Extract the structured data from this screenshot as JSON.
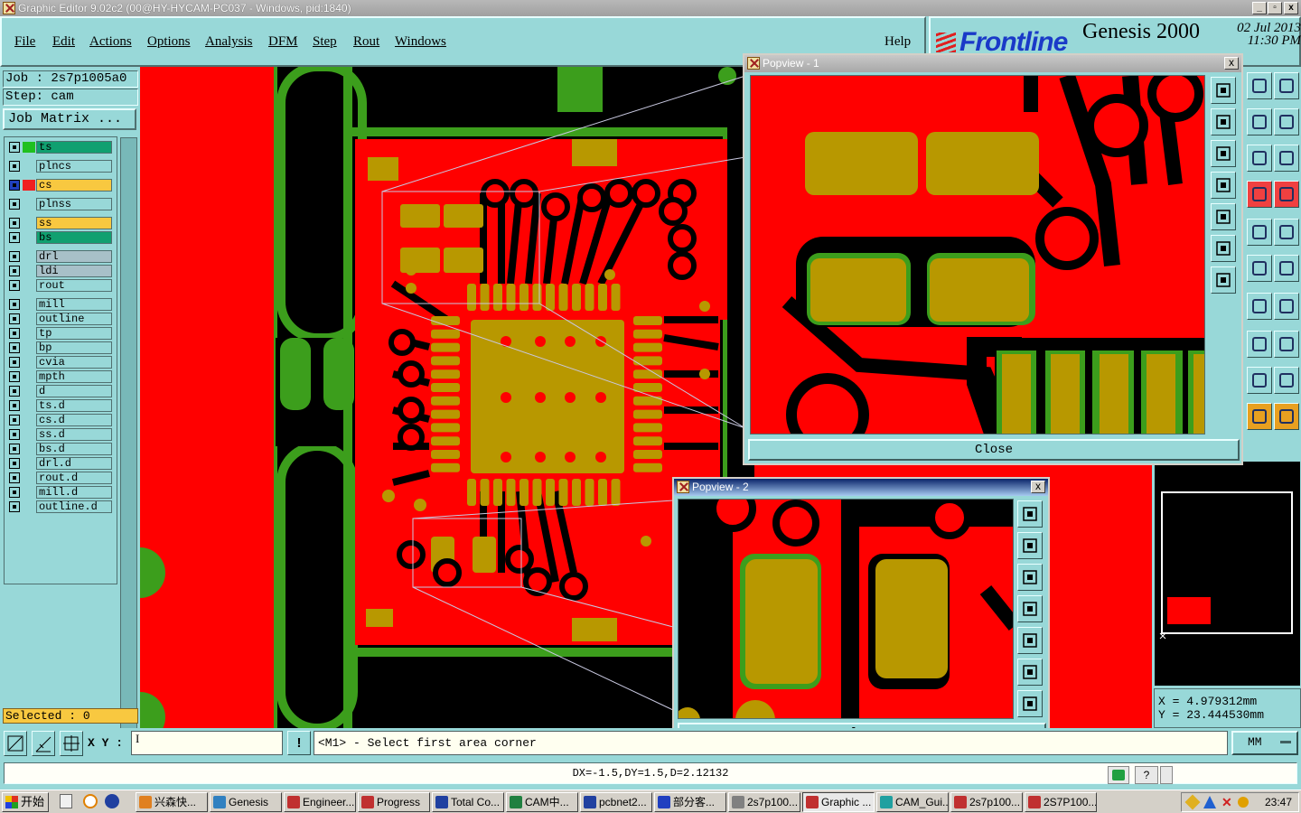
{
  "window": {
    "title": "Graphic Editor 9.02c2 (00@HY-HYCAM-PC037 - Windows, pid:1840)"
  },
  "menu": [
    "File",
    "Edit",
    "Actions",
    "Options",
    "Analysis",
    "DFM",
    "Step",
    "Rout",
    "Windows"
  ],
  "help": "Help",
  "brand": {
    "logo": "Frontline",
    "product": "Genesis 2000",
    "date": "02 Jul 2013",
    "time": "11:30 PM"
  },
  "job": {
    "job": "Job : 2s7p1005a0",
    "step": "Step: cam",
    "matrix_button": "Job Matrix ..."
  },
  "layers": [
    {
      "name": "ts",
      "color": "#10a070",
      "check": "#20c020"
    },
    {
      "name": "plncs",
      "color": "#98d8d8",
      "check": ""
    },
    {
      "name": "cs",
      "color": "#f8c840",
      "check": "#f02020",
      "selected": true
    },
    {
      "name": "plnss",
      "color": "#98d8d8",
      "check": ""
    },
    {
      "name": "ss",
      "color": "#f8c840",
      "check": ""
    },
    {
      "name": "bs",
      "color": "#10a070",
      "check": ""
    },
    {
      "name": "drl",
      "color": "#a8c0c8",
      "check": ""
    },
    {
      "name": "ldi",
      "color": "#a8c0c8",
      "check": ""
    },
    {
      "name": "rout",
      "color": "#98d8d8",
      "check": ""
    },
    {
      "name": "mill",
      "color": "#98d8d8",
      "check": ""
    },
    {
      "name": "outline",
      "color": "#98d8d8",
      "check": ""
    },
    {
      "name": "tp",
      "color": "#98d8d8",
      "check": ""
    },
    {
      "name": "bp",
      "color": "#98d8d8",
      "check": ""
    },
    {
      "name": "cvia",
      "color": "#98d8d8",
      "check": ""
    },
    {
      "name": "mpth",
      "color": "#98d8d8",
      "check": ""
    },
    {
      "name": "d",
      "color": "#98d8d8",
      "check": ""
    },
    {
      "name": "ts.d",
      "color": "#98d8d8",
      "check": ""
    },
    {
      "name": "cs.d",
      "color": "#98d8d8",
      "check": ""
    },
    {
      "name": "ss.d",
      "color": "#98d8d8",
      "check": ""
    },
    {
      "name": "bs.d",
      "color": "#98d8d8",
      "check": ""
    },
    {
      "name": "drl.d",
      "color": "#98d8d8",
      "check": ""
    },
    {
      "name": "rout.d",
      "color": "#98d8d8",
      "check": ""
    },
    {
      "name": "mill.d",
      "color": "#98d8d8",
      "check": ""
    },
    {
      "name": "outline.d",
      "color": "#98d8d8",
      "check": ""
    }
  ],
  "selected": "Selected : 0",
  "popview1": {
    "title": "Popview - 1",
    "close": "Close"
  },
  "popview2": {
    "title": "Popview - 2",
    "close": "Close"
  },
  "coords": {
    "x": "X  =  4.979312mm",
    "y": "Y  = 23.444530mm"
  },
  "cmd": {
    "xy_label": "X Y :",
    "prompt": "<M1> - Select first area corner",
    "units": "MM",
    "bang": "!"
  },
  "status": "DX=-1.5,DY=1.5,D=2.12132",
  "taskbar": {
    "start": "开始",
    "tasks": [
      {
        "label": "兴森快...",
        "icon": "#e08020"
      },
      {
        "label": "Genesis",
        "icon": "#3080c0"
      },
      {
        "label": "Engineer...",
        "icon": "#c03030"
      },
      {
        "label": "Progress",
        "icon": "#c03030"
      },
      {
        "label": "Total Co...",
        "icon": "#2040a0"
      },
      {
        "label": "CAM中...",
        "icon": "#208040"
      },
      {
        "label": "pcbnet2...",
        "icon": "#2040a0"
      },
      {
        "label": "部分客...",
        "icon": "#2040c0"
      },
      {
        "label": "2s7p100...",
        "icon": "#808080"
      },
      {
        "label": "Graphic ...",
        "icon": "#c03030",
        "active": true
      },
      {
        "label": "CAM_Gui...",
        "icon": "#20a0a0"
      },
      {
        "label": "2s7p100...",
        "icon": "#c03030"
      },
      {
        "label": "2S7P100...",
        "icon": "#c03030"
      }
    ],
    "clock": "23:47"
  },
  "colors": {
    "copper": "#ff0000",
    "pad": "#b89800",
    "mask": "#3c9e1c",
    "bg": "#98d8d8"
  }
}
